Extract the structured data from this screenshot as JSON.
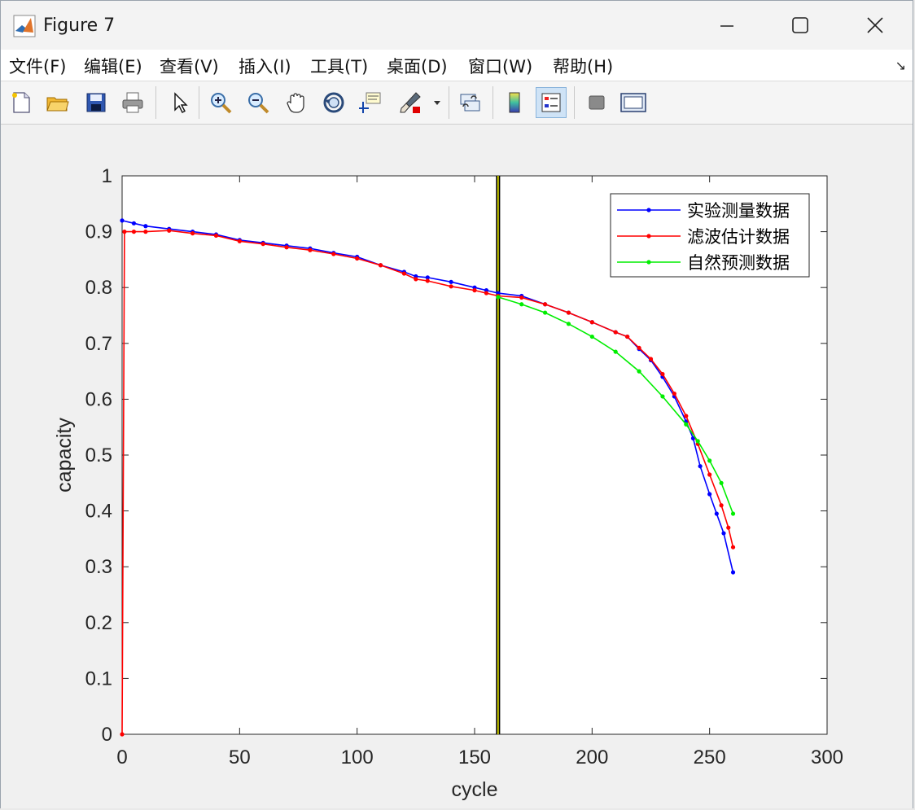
{
  "window": {
    "title": "Figure 7",
    "controls": {
      "minimize": "minimize",
      "maximize": "maximize",
      "close": "close"
    }
  },
  "menu": {
    "items": [
      "文件(F)",
      "编辑(E)",
      "查看(V)",
      "插入(I)",
      "工具(T)",
      "桌面(D)",
      "窗口(W)",
      "帮助(H)"
    ]
  },
  "toolbar": {
    "icons": [
      "new-figure-icon",
      "open-file-icon",
      "save-icon",
      "print-icon",
      "pointer-icon",
      "zoom-in-icon",
      "zoom-out-icon",
      "pan-hand-icon",
      "rotate-3d-icon",
      "data-cursor-icon",
      "brush-icon",
      "link-plot-icon",
      "colorbar-icon",
      "legend-icon",
      "hide-plot-tools-icon",
      "show-plot-tools-icon"
    ],
    "active": "legend-icon"
  },
  "chart_data": {
    "type": "line",
    "xlabel": "cycle",
    "ylabel": "capacity",
    "xlim": [
      0,
      300
    ],
    "ylim": [
      0,
      1
    ],
    "xticks": [
      "0",
      "50",
      "100",
      "150",
      "200",
      "250",
      "300"
    ],
    "yticks": [
      "0",
      "0.1",
      "0.2",
      "0.3",
      "0.4",
      "0.5",
      "0.6",
      "0.7",
      "0.8",
      "0.9",
      "1"
    ],
    "legend_position": "top-right",
    "grid": false,
    "vertical_marker_x": 160,
    "vertical_marker_colors": [
      "#000000",
      "#ffff00"
    ],
    "series": [
      {
        "name": "实验测量数据",
        "color": "#0000ff",
        "points": [
          [
            0,
            0.92
          ],
          [
            5,
            0.915
          ],
          [
            10,
            0.91
          ],
          [
            20,
            0.905
          ],
          [
            30,
            0.9
          ],
          [
            40,
            0.895
          ],
          [
            50,
            0.885
          ],
          [
            60,
            0.88
          ],
          [
            70,
            0.875
          ],
          [
            80,
            0.87
          ],
          [
            90,
            0.862
          ],
          [
            100,
            0.855
          ],
          [
            110,
            0.84
          ],
          [
            120,
            0.828
          ],
          [
            125,
            0.82
          ],
          [
            130,
            0.818
          ],
          [
            140,
            0.81
          ],
          [
            150,
            0.8
          ],
          [
            155,
            0.795
          ],
          [
            160,
            0.79
          ],
          [
            170,
            0.785
          ],
          [
            180,
            0.77
          ],
          [
            190,
            0.755
          ],
          [
            200,
            0.738
          ],
          [
            210,
            0.72
          ],
          [
            215,
            0.712
          ],
          [
            220,
            0.69
          ],
          [
            225,
            0.67
          ],
          [
            230,
            0.64
          ],
          [
            235,
            0.605
          ],
          [
            240,
            0.56
          ],
          [
            243,
            0.53
          ],
          [
            246,
            0.48
          ],
          [
            250,
            0.43
          ],
          [
            253,
            0.395
          ],
          [
            256,
            0.36
          ],
          [
            260,
            0.29
          ]
        ]
      },
      {
        "name": "滤波估计数据",
        "color": "#ff0000",
        "points": [
          [
            0,
            0.0
          ],
          [
            1,
            0.9
          ],
          [
            5,
            0.9
          ],
          [
            10,
            0.9
          ],
          [
            20,
            0.902
          ],
          [
            30,
            0.897
          ],
          [
            40,
            0.893
          ],
          [
            50,
            0.883
          ],
          [
            60,
            0.878
          ],
          [
            70,
            0.872
          ],
          [
            80,
            0.867
          ],
          [
            90,
            0.86
          ],
          [
            100,
            0.852
          ],
          [
            110,
            0.84
          ],
          [
            120,
            0.825
          ],
          [
            125,
            0.815
          ],
          [
            130,
            0.812
          ],
          [
            140,
            0.802
          ],
          [
            150,
            0.795
          ],
          [
            155,
            0.79
          ],
          [
            160,
            0.785
          ],
          [
            170,
            0.782
          ],
          [
            180,
            0.77
          ],
          [
            190,
            0.755
          ],
          [
            200,
            0.738
          ],
          [
            210,
            0.72
          ],
          [
            215,
            0.712
          ],
          [
            220,
            0.692
          ],
          [
            225,
            0.672
          ],
          [
            230,
            0.645
          ],
          [
            235,
            0.61
          ],
          [
            240,
            0.57
          ],
          [
            245,
            0.52
          ],
          [
            250,
            0.465
          ],
          [
            255,
            0.41
          ],
          [
            258,
            0.37
          ],
          [
            260,
            0.335
          ]
        ]
      },
      {
        "name": "自然预测数据",
        "color": "#00ee00",
        "points": [
          [
            160,
            0.783
          ],
          [
            170,
            0.77
          ],
          [
            180,
            0.755
          ],
          [
            190,
            0.735
          ],
          [
            200,
            0.712
          ],
          [
            210,
            0.685
          ],
          [
            220,
            0.65
          ],
          [
            230,
            0.605
          ],
          [
            240,
            0.555
          ],
          [
            245,
            0.525
          ],
          [
            250,
            0.49
          ],
          [
            255,
            0.45
          ],
          [
            260,
            0.395
          ]
        ]
      }
    ]
  }
}
